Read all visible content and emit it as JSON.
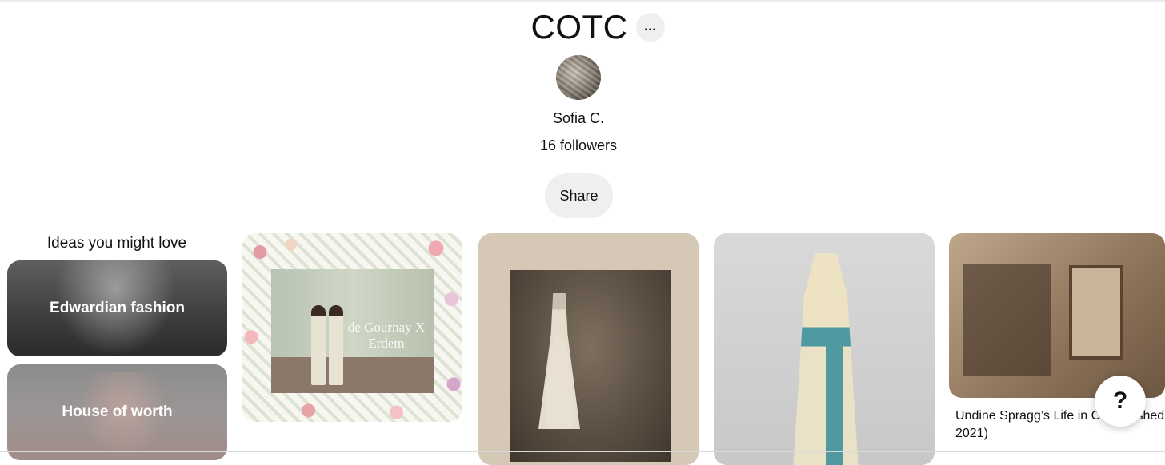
{
  "board": {
    "title": "COTC",
    "more_icon": "…",
    "owner_name": "Sofia C.",
    "followers_text": "16 followers",
    "share_label": "Share"
  },
  "ideas": {
    "heading": "Ideas you might love",
    "items": [
      {
        "label": "Edwardian fashion"
      },
      {
        "label": "House of worth"
      }
    ]
  },
  "pins": [
    {
      "image_text": "de Gournay X Erdem"
    },
    {
      "image_text": ""
    },
    {
      "image_text": ""
    },
    {
      "caption": "Undine Spragg’s Life in C (Published 2021)"
    }
  ],
  "help": {
    "label": "?"
  },
  "icons": [
    "more-icon",
    "help-icon"
  ]
}
